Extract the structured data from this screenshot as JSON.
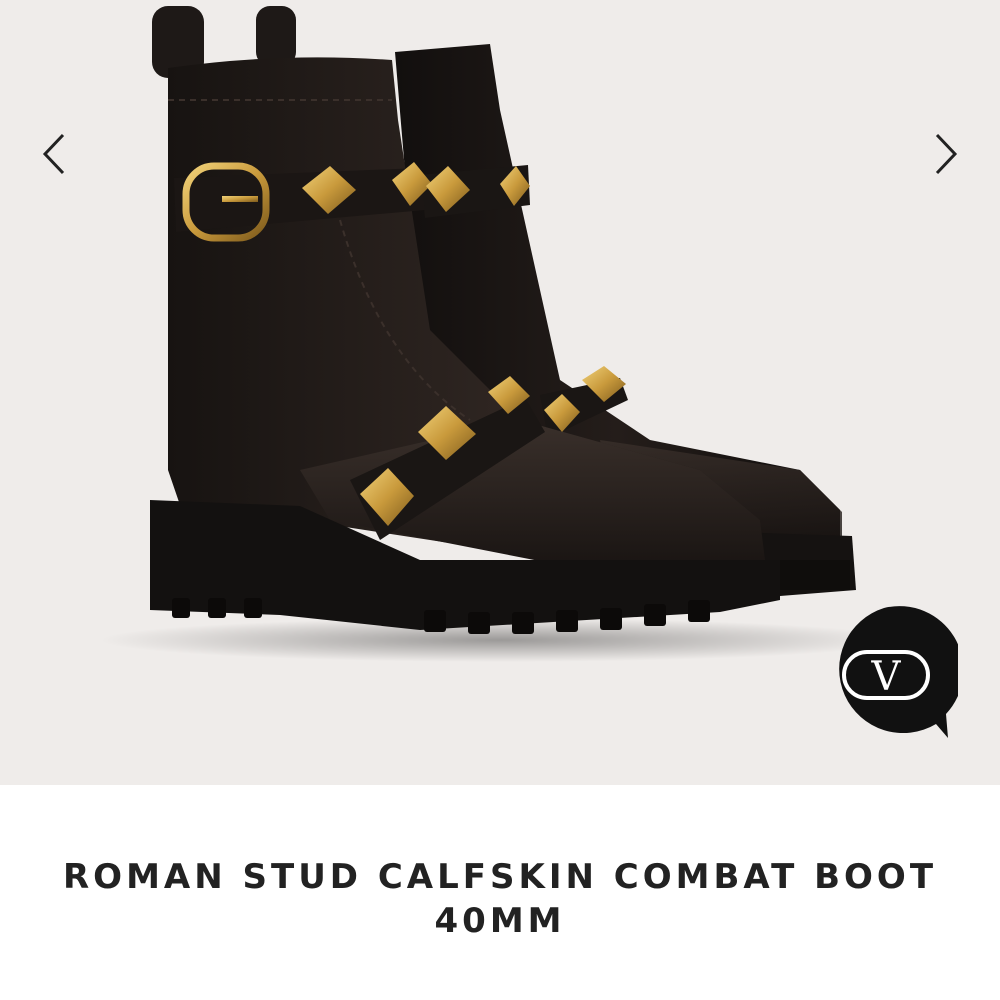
{
  "gallery": {
    "background_color": "#efecea",
    "image_alt": "Black leather combat boots with gold pyramid studs and buckle strap",
    "prev_icon": "chevron-left-icon",
    "next_icon": "chevron-right-icon",
    "badge": {
      "icon": "valentino-v-logo-icon",
      "monogram": "V",
      "color": "#111111"
    }
  },
  "product": {
    "title_line1": "ROMAN STUD CALFSKIN COMBAT BOOT",
    "title_line2": "40MM"
  },
  "colors": {
    "leather": "#1c1816",
    "stud_gold": "#c9a24a",
    "title_text": "#222222"
  }
}
